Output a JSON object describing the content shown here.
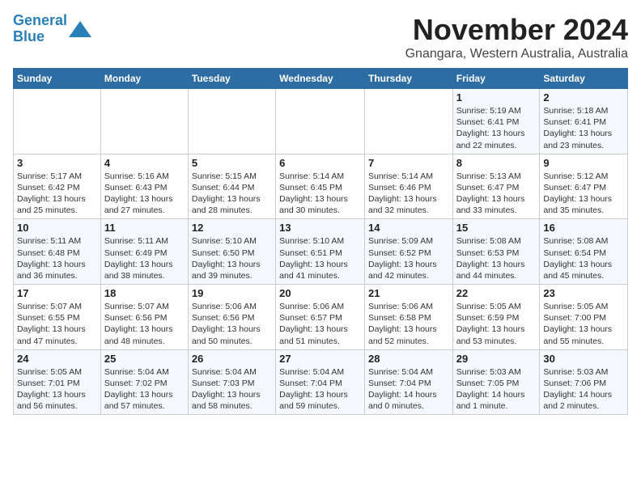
{
  "app": {
    "logo_line1": "General",
    "logo_line2": "Blue"
  },
  "header": {
    "month_year": "November 2024",
    "location": "Gnangara, Western Australia, Australia"
  },
  "weekdays": [
    "Sunday",
    "Monday",
    "Tuesday",
    "Wednesday",
    "Thursday",
    "Friday",
    "Saturday"
  ],
  "weeks": [
    [
      {
        "day": "",
        "info": ""
      },
      {
        "day": "",
        "info": ""
      },
      {
        "day": "",
        "info": ""
      },
      {
        "day": "",
        "info": ""
      },
      {
        "day": "",
        "info": ""
      },
      {
        "day": "1",
        "info": "Sunrise: 5:19 AM\nSunset: 6:41 PM\nDaylight: 13 hours and 22 minutes."
      },
      {
        "day": "2",
        "info": "Sunrise: 5:18 AM\nSunset: 6:41 PM\nDaylight: 13 hours and 23 minutes."
      }
    ],
    [
      {
        "day": "3",
        "info": "Sunrise: 5:17 AM\nSunset: 6:42 PM\nDaylight: 13 hours and 25 minutes."
      },
      {
        "day": "4",
        "info": "Sunrise: 5:16 AM\nSunset: 6:43 PM\nDaylight: 13 hours and 27 minutes."
      },
      {
        "day": "5",
        "info": "Sunrise: 5:15 AM\nSunset: 6:44 PM\nDaylight: 13 hours and 28 minutes."
      },
      {
        "day": "6",
        "info": "Sunrise: 5:14 AM\nSunset: 6:45 PM\nDaylight: 13 hours and 30 minutes."
      },
      {
        "day": "7",
        "info": "Sunrise: 5:14 AM\nSunset: 6:46 PM\nDaylight: 13 hours and 32 minutes."
      },
      {
        "day": "8",
        "info": "Sunrise: 5:13 AM\nSunset: 6:47 PM\nDaylight: 13 hours and 33 minutes."
      },
      {
        "day": "9",
        "info": "Sunrise: 5:12 AM\nSunset: 6:47 PM\nDaylight: 13 hours and 35 minutes."
      }
    ],
    [
      {
        "day": "10",
        "info": "Sunrise: 5:11 AM\nSunset: 6:48 PM\nDaylight: 13 hours and 36 minutes."
      },
      {
        "day": "11",
        "info": "Sunrise: 5:11 AM\nSunset: 6:49 PM\nDaylight: 13 hours and 38 minutes."
      },
      {
        "day": "12",
        "info": "Sunrise: 5:10 AM\nSunset: 6:50 PM\nDaylight: 13 hours and 39 minutes."
      },
      {
        "day": "13",
        "info": "Sunrise: 5:10 AM\nSunset: 6:51 PM\nDaylight: 13 hours and 41 minutes."
      },
      {
        "day": "14",
        "info": "Sunrise: 5:09 AM\nSunset: 6:52 PM\nDaylight: 13 hours and 42 minutes."
      },
      {
        "day": "15",
        "info": "Sunrise: 5:08 AM\nSunset: 6:53 PM\nDaylight: 13 hours and 44 minutes."
      },
      {
        "day": "16",
        "info": "Sunrise: 5:08 AM\nSunset: 6:54 PM\nDaylight: 13 hours and 45 minutes."
      }
    ],
    [
      {
        "day": "17",
        "info": "Sunrise: 5:07 AM\nSunset: 6:55 PM\nDaylight: 13 hours and 47 minutes."
      },
      {
        "day": "18",
        "info": "Sunrise: 5:07 AM\nSunset: 6:56 PM\nDaylight: 13 hours and 48 minutes."
      },
      {
        "day": "19",
        "info": "Sunrise: 5:06 AM\nSunset: 6:56 PM\nDaylight: 13 hours and 50 minutes."
      },
      {
        "day": "20",
        "info": "Sunrise: 5:06 AM\nSunset: 6:57 PM\nDaylight: 13 hours and 51 minutes."
      },
      {
        "day": "21",
        "info": "Sunrise: 5:06 AM\nSunset: 6:58 PM\nDaylight: 13 hours and 52 minutes."
      },
      {
        "day": "22",
        "info": "Sunrise: 5:05 AM\nSunset: 6:59 PM\nDaylight: 13 hours and 53 minutes."
      },
      {
        "day": "23",
        "info": "Sunrise: 5:05 AM\nSunset: 7:00 PM\nDaylight: 13 hours and 55 minutes."
      }
    ],
    [
      {
        "day": "24",
        "info": "Sunrise: 5:05 AM\nSunset: 7:01 PM\nDaylight: 13 hours and 56 minutes."
      },
      {
        "day": "25",
        "info": "Sunrise: 5:04 AM\nSunset: 7:02 PM\nDaylight: 13 hours and 57 minutes."
      },
      {
        "day": "26",
        "info": "Sunrise: 5:04 AM\nSunset: 7:03 PM\nDaylight: 13 hours and 58 minutes."
      },
      {
        "day": "27",
        "info": "Sunrise: 5:04 AM\nSunset: 7:04 PM\nDaylight: 13 hours and 59 minutes."
      },
      {
        "day": "28",
        "info": "Sunrise: 5:04 AM\nSunset: 7:04 PM\nDaylight: 14 hours and 0 minutes."
      },
      {
        "day": "29",
        "info": "Sunrise: 5:03 AM\nSunset: 7:05 PM\nDaylight: 14 hours and 1 minute."
      },
      {
        "day": "30",
        "info": "Sunrise: 5:03 AM\nSunset: 7:06 PM\nDaylight: 14 hours and 2 minutes."
      }
    ]
  ]
}
